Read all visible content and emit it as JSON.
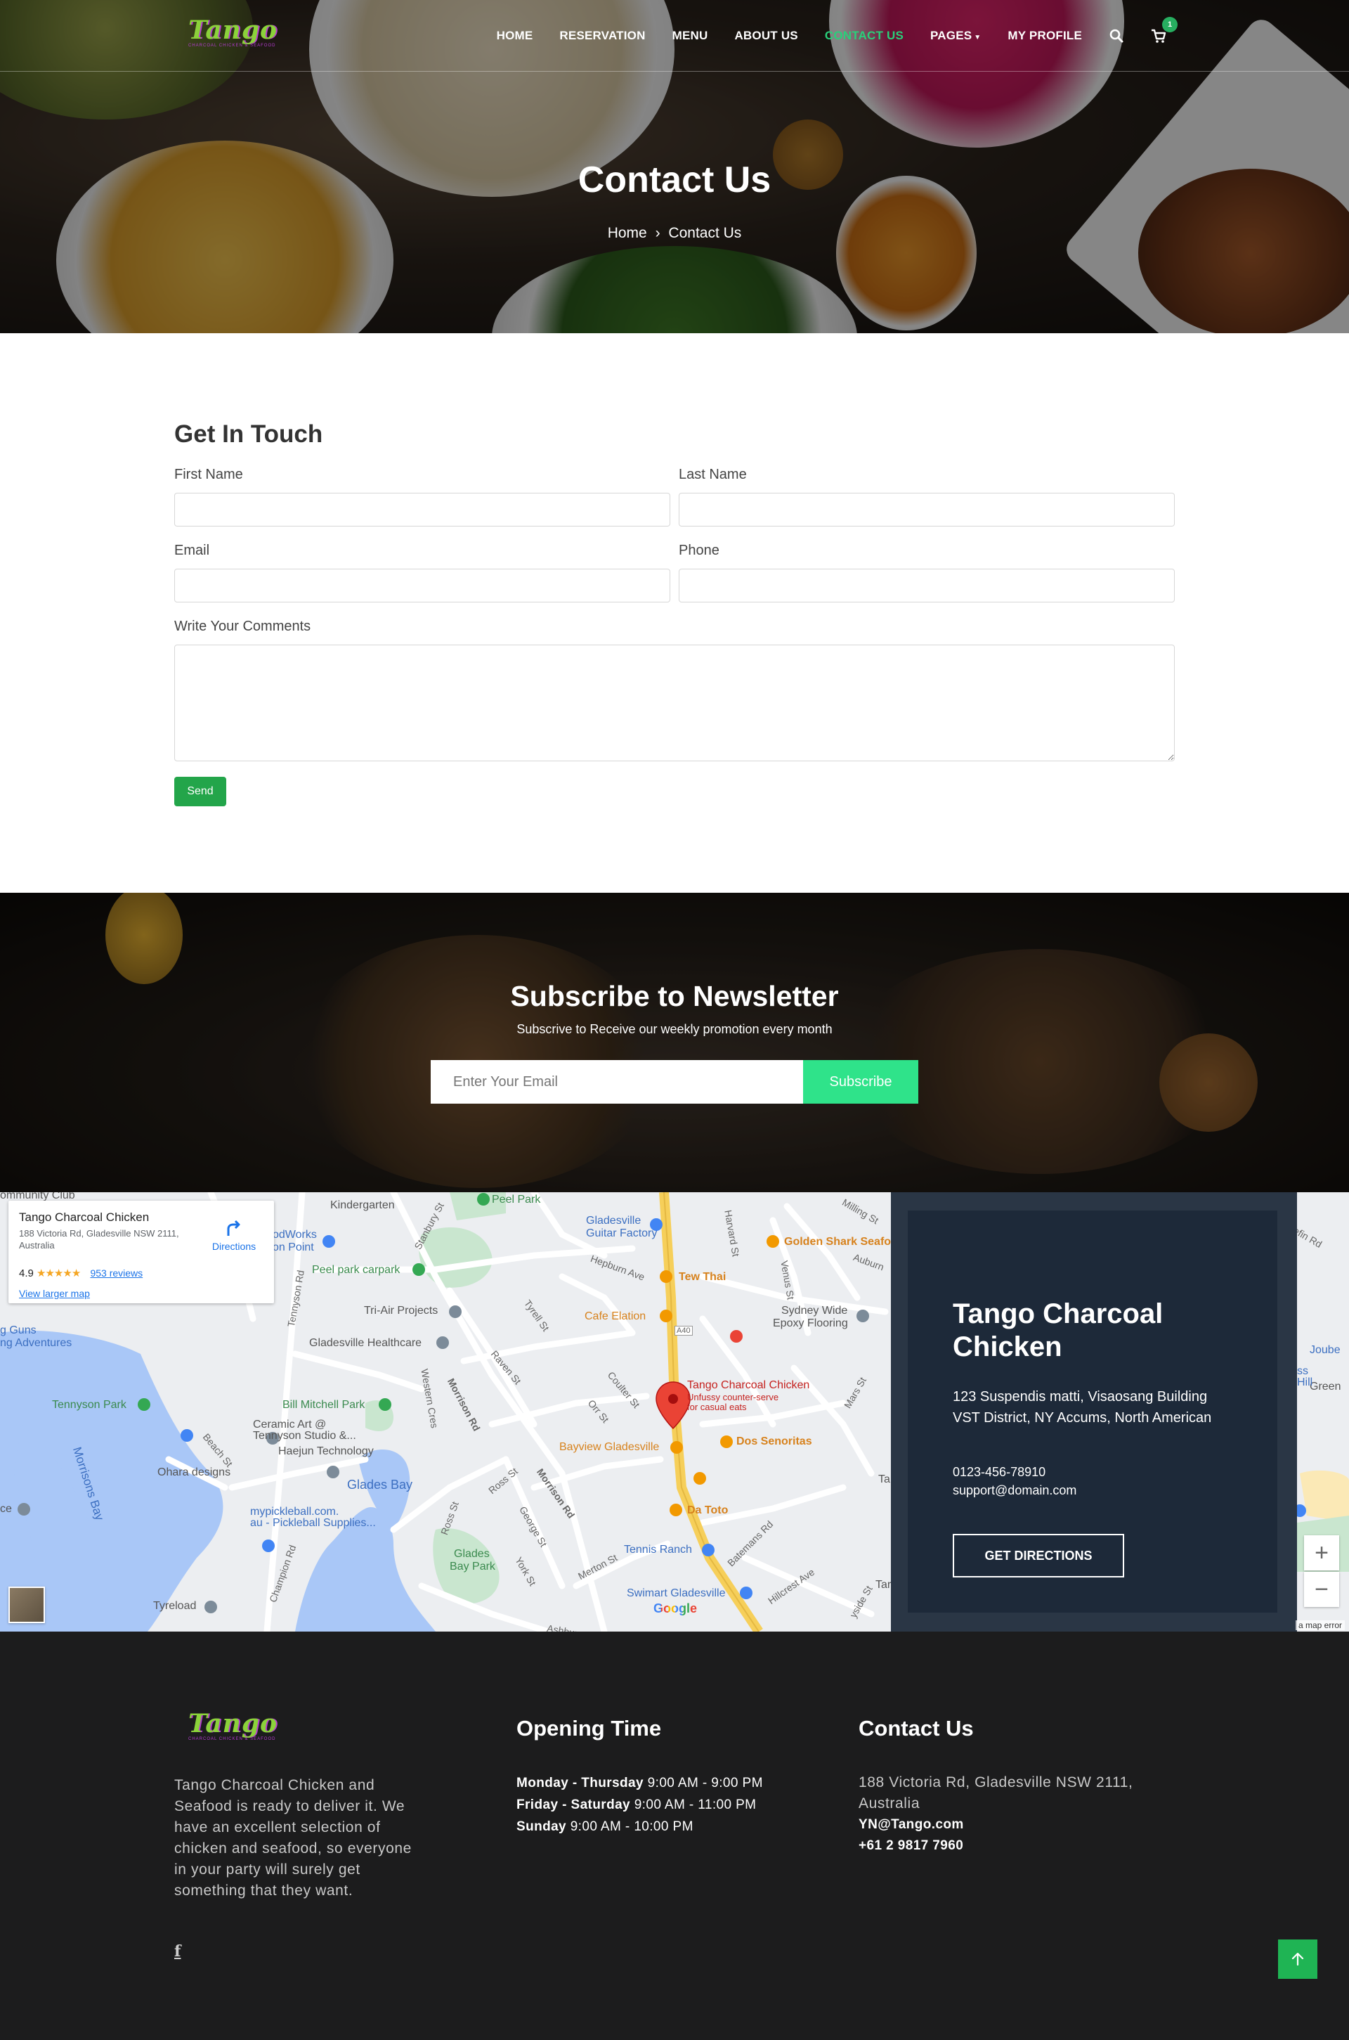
{
  "brand": {
    "logo_text": "Tango",
    "tagline": "CHARCOAL CHICKEN & SEAFOOD"
  },
  "nav": {
    "items": [
      {
        "label": "HOME"
      },
      {
        "label": "RESERVATION"
      },
      {
        "label": "MENU"
      },
      {
        "label": "ABOUT US"
      },
      {
        "label": "CONTACT US",
        "active": true
      },
      {
        "label": "PAGES"
      },
      {
        "label": "MY PROFILE"
      }
    ],
    "cart_count": "1",
    "active_color": "#29d07a"
  },
  "hero": {
    "title": "Contact Us",
    "breadcrumb": {
      "home": "Home",
      "separator": "›",
      "current": "Contact Us"
    }
  },
  "contact_form": {
    "title": "Get In Touch",
    "first_name_label": "First Name",
    "last_name_label": "Last Name",
    "email_label": "Email",
    "phone_label": "Phone",
    "comments_label": "Write Your Comments",
    "first_name_value": "",
    "last_name_value": "",
    "email_value": "",
    "phone_value": "",
    "comments_value": "",
    "send_label": "Send",
    "send_color": "#23a54a"
  },
  "newsletter": {
    "title": "Subscribe to Newsletter",
    "subtitle": "Subscrive to Receive our weekly promotion every month",
    "email_placeholder": "Enter Your Email",
    "button_label": "Subscribe",
    "button_color": "#2fe38a"
  },
  "map": {
    "card": {
      "title": "Tango Charcoal Chicken",
      "address": "188 Victoria Rd, Gladesville NSW 2111, Australia",
      "rating": "4.9",
      "stars": "★★★★★",
      "reviews": "953 reviews",
      "view_larger": "View larger map",
      "directions": "Directions"
    },
    "pin_label": "Tango Charcoal Chicken",
    "pin_sublabel_1": "Unfussy counter-serve",
    "pin_sublabel_2": "for casual eats",
    "labels": {
      "peel_park": "Peel Park",
      "kindergarten": "Kindergarten",
      "gladesville_guitar_1": "Gladesville",
      "gladesville_guitar_2": "Guitar Factory",
      "golden_shark": "Golden Shark Seafo",
      "woodworks_1": "odWorks",
      "woodworks_2": "on Point",
      "peel_park_carpark": "Peel park carpark",
      "tew_thai": "Tew Thai",
      "tri_air": "Tri-Air Projects",
      "cafe_elation": "Cafe Elation",
      "sydney_wide_1": "Sydney Wide",
      "sydney_wide_2": "Epoxy Flooring",
      "guns_1": "g Guns",
      "guns_2": "ng Adventures",
      "healthcare": "Gladesville Healthcare",
      "tennyson_park": "Tennyson Park",
      "bill_mitchell": "Bill Mitchell Park",
      "ceramic_1": "Ceramic Art @",
      "ceramic_2": "Tennyson Studio &...",
      "haejun": "Haejun Technology",
      "bayview": "Bayview Gladesville",
      "dos_senoritas": "Dos Senoritas",
      "morrisons_bay": "Morrisons Bay",
      "ohara": "Ohara designs",
      "glades_bay": "Glades Bay",
      "pickleball_1": "mypickleball.com.",
      "pickleball_2": "au - Pickleball Supplies...",
      "da_toto": "Da Toto",
      "glades_bay_park_1": "Glades",
      "glades_bay_park_2": "Bay Park",
      "tennis_ranch": "Tennis Ranch",
      "swimart": "Swimart Gladesville",
      "tyreload": "Tyreload",
      "community_club": "ommunity Club",
      "joubert": "Joube",
      "green": "Green",
      "hill_1": "ss",
      "hill_2": "Hill",
      "ta_1": "Ta",
      "ta_2": "Tar",
      "ce": "ce"
    },
    "streets": {
      "stanbury": "Stanbury St",
      "tennyson_rd": "Tennyson Rd",
      "western_cres": "Western Cres",
      "morrison_rd": "Morrison Rd",
      "raven": "Raven St",
      "tyrell": "Tyrell St",
      "hepburn": "Hepburn Ave",
      "a40": "A40",
      "coulter": "Coulter St",
      "orr": "Orr St",
      "venus": "Venus St",
      "mars": "Mars St",
      "beach": "Beach St",
      "ross": "Ross St",
      "george": "George St",
      "york": "York St",
      "merton": "Merton St",
      "champion": "Champion Rd",
      "batemans": "Batemans Rd",
      "hillcrest": "Hillcrest Ave",
      "harvard": "Harvard St",
      "milling": "Milling St",
      "auburn": "Auburn",
      "ashburn": "Ashburn",
      "tennyson_kinder": "Tennyson Rd",
      "riverside": "yside St",
      "brent": "Brent St",
      "elfin": "efin Rd"
    },
    "google": "Google",
    "map_error": "a map error",
    "zoom_in": "+",
    "zoom_out": "−"
  },
  "info_panel": {
    "title": "Tango Charcoal Chicken",
    "address": "123 Suspendis matti, Visaosang Building VST District, NY Accums, North American",
    "phone": "0123-456-78910",
    "email": "support@domain.com",
    "button_label": "GET DIRECTIONS"
  },
  "footer": {
    "about": "Tango Charcoal Chicken and Seafood is ready to deliver it. We have an excellent selection of chicken and seafood, so everyone in your party will surely get something that they want.",
    "facebook_glyph": "f",
    "opening_title": "Opening Time",
    "hours": [
      {
        "days": "Monday - Thursday",
        "time": "9:00 AM - 9:00 PM"
      },
      {
        "days": "Friday - Saturday",
        "time": " 9:00 AM - 11:00 PM"
      },
      {
        "days": "Sunday",
        "time": "9:00 AM - 10:00 PM"
      }
    ],
    "contact_title": "Contact Us",
    "contact_address": "188 Victoria Rd, Gladesville NSW 2111, Australia",
    "contact_email": "YN@Tango.com",
    "contact_phone": "+61 2 9817 7960"
  }
}
